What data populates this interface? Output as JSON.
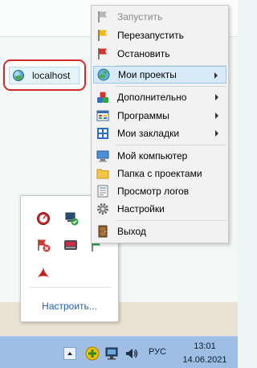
{
  "localhost_item": {
    "label": "localhost"
  },
  "context_menu": {
    "items": [
      {
        "label": "Запустить",
        "icon": "gray-flag-icon",
        "disabled": true
      },
      {
        "label": "Перезапустить",
        "icon": "yellow-flag-icon"
      },
      {
        "label": "Остановить",
        "icon": "red-flag-icon"
      },
      {
        "label": "Мои проекты",
        "icon": "globe-icon",
        "submenu": true,
        "highlighted": true
      },
      {
        "label": "Дополнительно",
        "icon": "color-blocks-icon",
        "submenu": true
      },
      {
        "label": "Программы",
        "icon": "programs-icon",
        "submenu": true
      },
      {
        "label": "Мои закладки",
        "icon": "bookmarks-icon",
        "submenu": true
      },
      {
        "label": "Мой компьютер",
        "icon": "computer-icon"
      },
      {
        "label": "Папка с проектами",
        "icon": "folder-icon"
      },
      {
        "label": "Просмотр логов",
        "icon": "log-icon"
      },
      {
        "label": "Настройки",
        "icon": "gear-icon"
      },
      {
        "label": "Выход",
        "icon": "exit-door-icon"
      }
    ]
  },
  "tray_popup": {
    "customize_label": "Настроить...",
    "icons": [
      "speedometer-icon",
      "network-check-icon",
      "red-flag-error-icon",
      "media-icon",
      "green-flag-icon",
      "acrobat-icon"
    ]
  },
  "taskbar": {
    "language": "РУС",
    "time": "13:01",
    "date": "14.06.2021"
  },
  "colors": {
    "highlight_bg": "#d8eaf9",
    "highlight_border": "#99c8ef",
    "annotation_red": "#d22a2a",
    "taskbar": "#9ebfe3",
    "link_blue": "#1e5eb0"
  }
}
